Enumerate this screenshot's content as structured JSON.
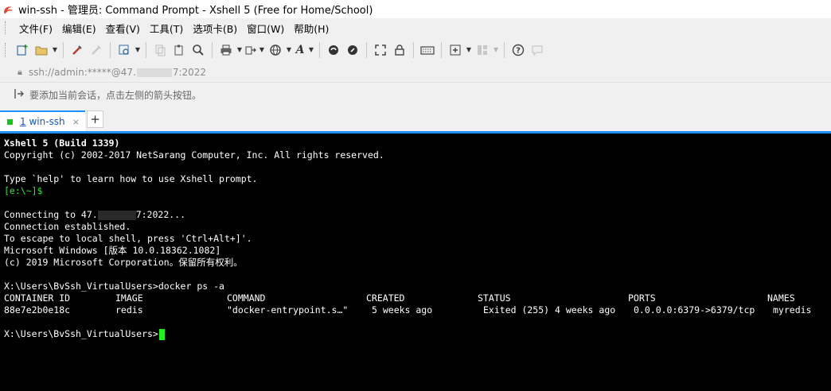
{
  "window": {
    "title": "win-ssh - 管理员: Command Prompt - Xshell 5 (Free for Home/School)"
  },
  "menu": [
    {
      "label": "文件(F)"
    },
    {
      "label": "编辑(E)"
    },
    {
      "label": "查看(V)"
    },
    {
      "label": "工具(T)"
    },
    {
      "label": "选项卡(B)"
    },
    {
      "label": "窗口(W)"
    },
    {
      "label": "帮助(H)"
    }
  ],
  "address": {
    "prefix": "ssh://admin:*****@47.",
    "suffix": "7:2022"
  },
  "hint": {
    "text": "要添加当前会话，点击左侧的箭头按钮。"
  },
  "tab": {
    "number": "1",
    "label": "win-ssh",
    "close": "×"
  },
  "newtab": {
    "label": "+"
  },
  "terminal": {
    "header": "Xshell 5 (Build 1339)",
    "copyright": "Copyright (c) 2002-2017 NetSarang Computer, Inc. All rights reserved.",
    "help": "Type `help' to learn how to use Xshell prompt.",
    "local_prompt": "[e:\\~]$",
    "connecting_prefix": "Connecting to 47.",
    "connecting_suffix": "7:2022...",
    "established": "Connection established.",
    "escape": "To escape to local shell, press 'Ctrl+Alt+]'.",
    "windows_version": "Microsoft Windows [版本 10.0.18362.1082]",
    "ms_copyright": "(c) 2019 Microsoft Corporation。保留所有权利。",
    "command_line": "X:\\Users\\BvSsh_VirtualUsers>docker ps -a",
    "docker_headers": [
      "CONTAINER ID",
      "IMAGE",
      "COMMAND",
      "CREATED",
      "STATUS",
      "PORTS",
      "NAMES"
    ],
    "docker_row": [
      "88e7e2b0e18c",
      "redis",
      "\"docker-entrypoint.s…\"",
      "5 weeks ago",
      "Exited (255) 4 weeks ago",
      "0.0.0.0:6379->6379/tcp",
      "myredis"
    ],
    "final_prompt": "X:\\Users\\BvSsh_VirtualUsers>"
  }
}
